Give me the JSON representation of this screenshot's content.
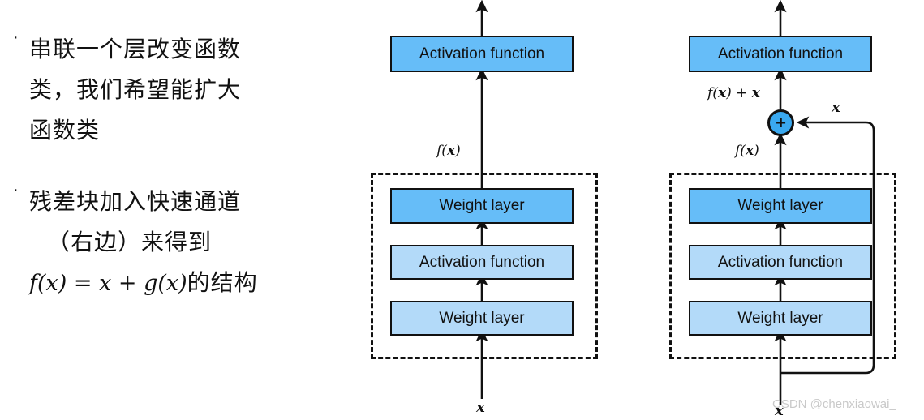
{
  "slide": {
    "bullets": [
      {
        "marker": "·",
        "lines": [
          "串联一个层改变函数",
          "类，我们希望能扩大",
          "函数类"
        ]
      },
      {
        "marker": "·",
        "lines": [
          "残差块加入快速通道",
          "（右边）来得到"
        ],
        "formula_math": "f(x) = x + g(x)",
        "formula_tail": "的结构"
      }
    ]
  },
  "diagrams": {
    "left": {
      "name": "plain-block",
      "output_arrow_label": "",
      "top_box": "Activation function",
      "mid_label": "f(x)",
      "inner_boxes": [
        "Weight layer",
        "Activation function",
        "Weight layer"
      ],
      "input_label": "x"
    },
    "right": {
      "name": "residual-block",
      "top_box": "Activation function",
      "sum_label": "f(x) + x",
      "plus_symbol": "+",
      "skip_label": "x",
      "mid_label": "f(x)",
      "inner_boxes": [
        "Weight layer",
        "Activation function",
        "Weight layer"
      ],
      "input_label": "x"
    }
  },
  "watermark": "CSDN @chenxiaowai_",
  "colors": {
    "fill_strong": "#66bdf8",
    "fill_light": "#b3daf9",
    "plus_fill": "#3aa9f0",
    "stroke": "#111111",
    "watermark": "#c9c9c9"
  }
}
